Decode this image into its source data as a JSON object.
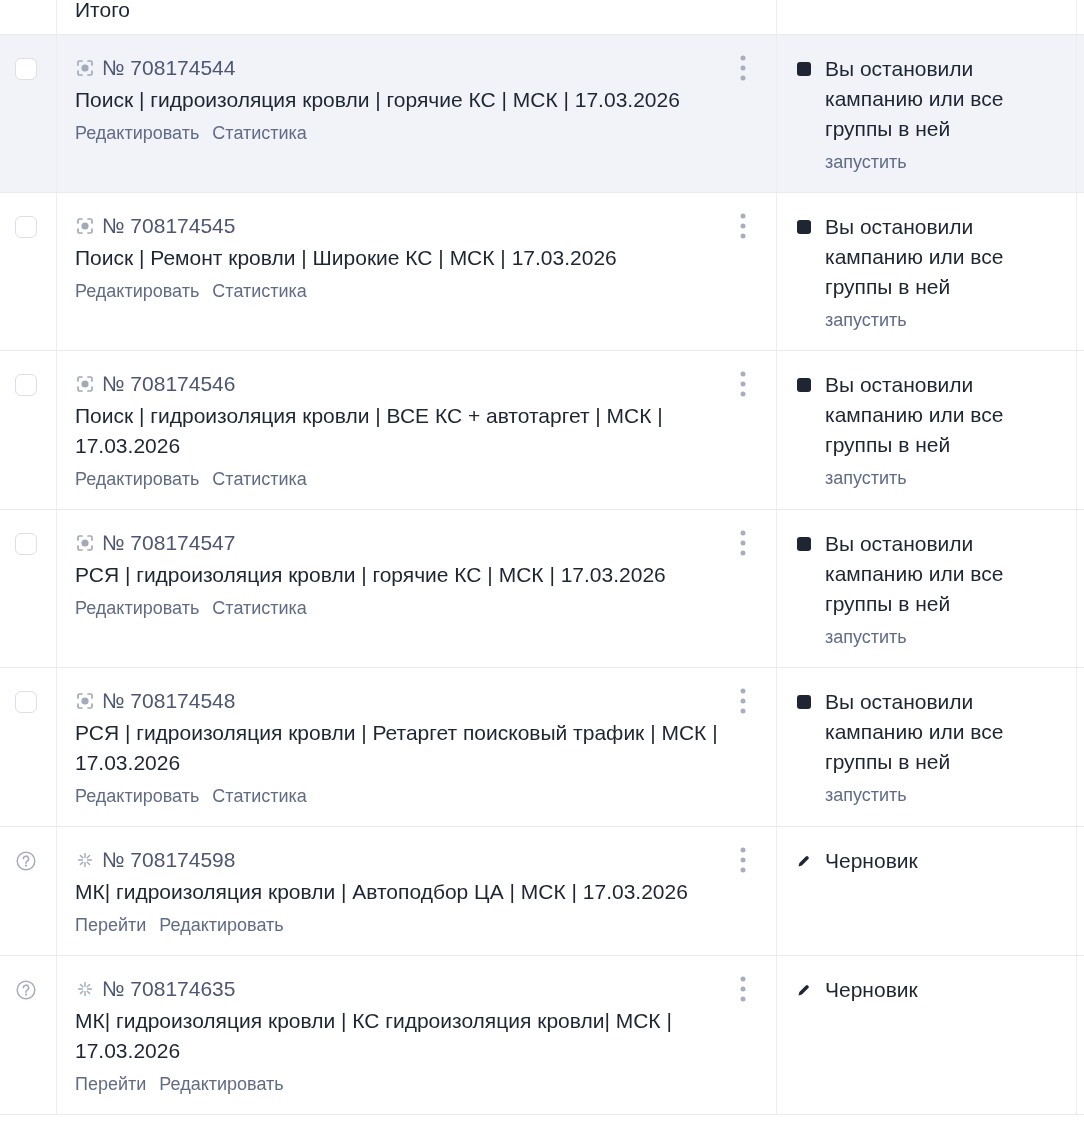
{
  "table": {
    "total_row": {
      "label": "Итого"
    },
    "rows": [
      {
        "kind": "standard",
        "highlighted": true,
        "checked": false,
        "number": "№ 708174544",
        "title": "Поиск | гидроизоляция кровли | горячие КС | МСК | 17.03.2026",
        "links": [
          "Редактировать",
          "Статистика"
        ],
        "status": {
          "kind": "stopped",
          "text": "Вы остановили кампанию или все группы в ней",
          "action": "запустить"
        }
      },
      {
        "kind": "standard",
        "highlighted": false,
        "checked": false,
        "number": "№ 708174545",
        "title": "Поиск | Ремонт кровли | Широкие КС | МСК | 17.03.2026",
        "links": [
          "Редактировать",
          "Статистика"
        ],
        "status": {
          "kind": "stopped",
          "text": "Вы остановили кампанию или все группы в ней",
          "action": "запустить"
        }
      },
      {
        "kind": "standard",
        "highlighted": false,
        "checked": false,
        "number": "№ 708174546",
        "title": "Поиск | гидроизоляция кровли | ВСЕ КС + автотаргет | МСК | 17.03.2026",
        "links": [
          "Редактировать",
          "Статистика"
        ],
        "status": {
          "kind": "stopped",
          "text": "Вы остановили кампанию или все группы в ней",
          "action": "запустить"
        }
      },
      {
        "kind": "standard",
        "highlighted": false,
        "checked": false,
        "number": "№ 708174547",
        "title": "РСЯ | гидроизоляция кровли | горячие КС | МСК | 17.03.2026",
        "links": [
          "Редактировать",
          "Статистика"
        ],
        "status": {
          "kind": "stopped",
          "text": "Вы остановили кампанию или все группы в ней",
          "action": "запустить"
        }
      },
      {
        "kind": "standard",
        "highlighted": false,
        "checked": false,
        "number": "№ 708174548",
        "title": "РСЯ | гидроизоляция кровли | Ретаргет поисковый трафик | МСК | 17.03.2026",
        "links": [
          "Редактировать",
          "Статистика"
        ],
        "status": {
          "kind": "stopped",
          "text": "Вы остановили кампанию или все группы в ней",
          "action": "запустить"
        }
      },
      {
        "kind": "draft",
        "highlighted": false,
        "number": "№ 708174598",
        "title": "МК| гидроизоляция кровли | Автоподбор ЦА | МСК | 17.03.2026",
        "links": [
          "Перейти",
          "Редактировать"
        ],
        "status": {
          "kind": "draft",
          "text": "Черновик"
        }
      },
      {
        "kind": "draft",
        "highlighted": false,
        "number": "№ 708174635",
        "title": "МК| гидроизоляция кровли | КС гидроизоляция кровли| МСК | 17.03.2026",
        "links": [
          "Перейти",
          "Редактировать"
        ],
        "status": {
          "kind": "draft",
          "text": "Черновик"
        }
      }
    ]
  }
}
